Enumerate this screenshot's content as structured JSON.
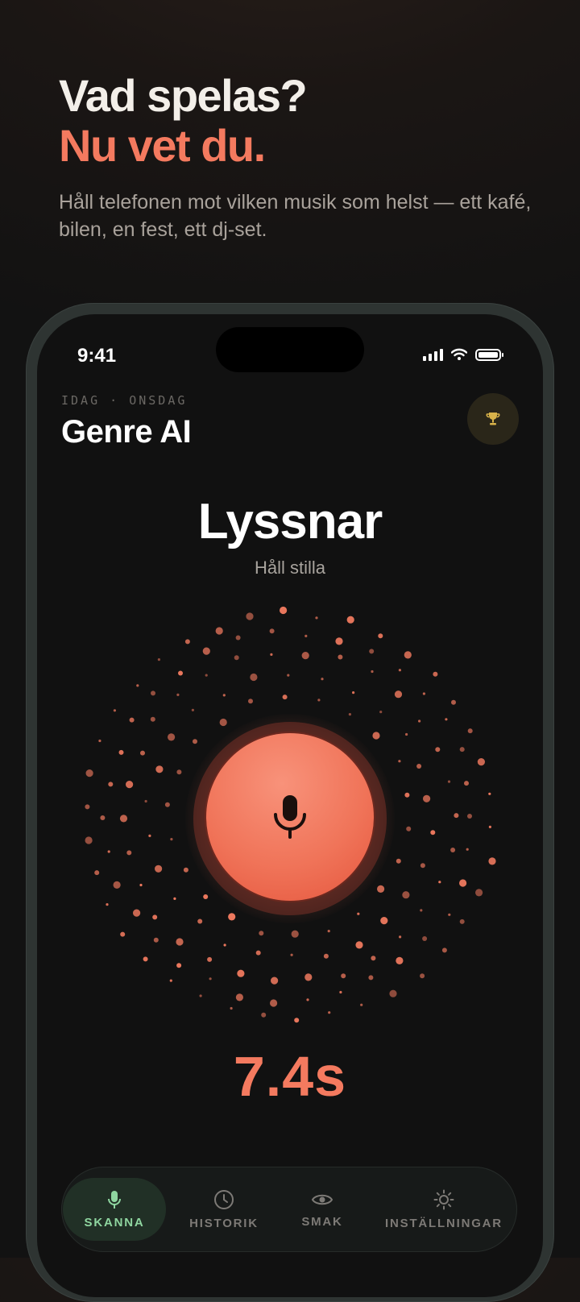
{
  "hero": {
    "line1": "Vad spelas?",
    "line2": "Nu vet du.",
    "subtitle": "Håll telefonen mot vilken musik som helst — ett kafé, bilen, en fest, ett dj-set."
  },
  "status_bar": {
    "time": "9:41"
  },
  "header": {
    "kicker": "IDAG · ONSDAG",
    "title": "Genre AI"
  },
  "listening": {
    "title": "Lyssnar",
    "subtitle": "Håll stilla",
    "timer": "7.4s"
  },
  "tabs": [
    {
      "label": "SKANNA",
      "icon": "mic-icon",
      "active": true
    },
    {
      "label": "HISTORIK",
      "icon": "clock-icon",
      "active": false
    },
    {
      "label": "SMAK",
      "icon": "eye-icon",
      "active": false
    },
    {
      "label": "INSTÄLLNINGAR",
      "icon": "sun-gear-icon",
      "active": false
    }
  ],
  "colors": {
    "accent": "#f47a5f",
    "active_tab": "#8fd6a0",
    "trophy": "#d9b34a"
  }
}
